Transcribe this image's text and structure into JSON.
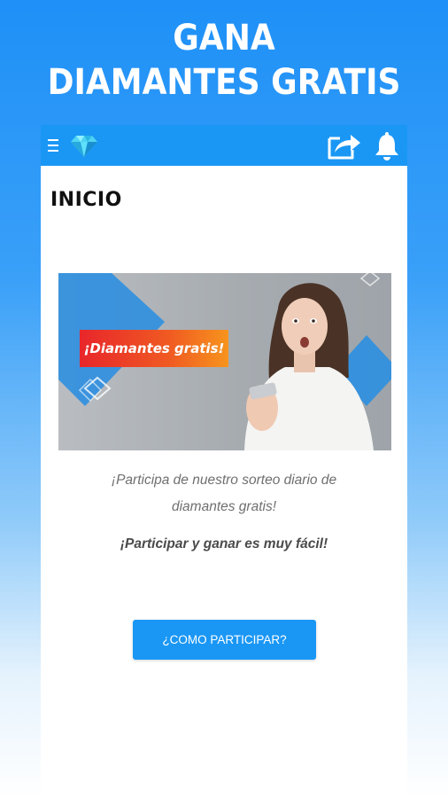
{
  "promo": {
    "line1": "GANA",
    "line2": "DIAMANTES GRATIS"
  },
  "appbar": {
    "icons": [
      "menu-icon",
      "diamond-icon",
      "share-icon",
      "bell-icon"
    ],
    "color": "#1a97f5"
  },
  "page": {
    "heading": "INICIO"
  },
  "banner": {
    "tag": "¡Diamantes gratis!"
  },
  "content": {
    "description_line1": "¡Participa de nuestro sorteo diario de",
    "description_line2": "diamantes gratis!",
    "cta_text": "¡Participar y ganar es muy fácil!",
    "button_label": "¿COMO PARTICIPAR?"
  },
  "colors": {
    "accent": "#1a97f5",
    "tag_gradient_start": "#e8262b",
    "tag_gradient_end": "#f7941d"
  }
}
